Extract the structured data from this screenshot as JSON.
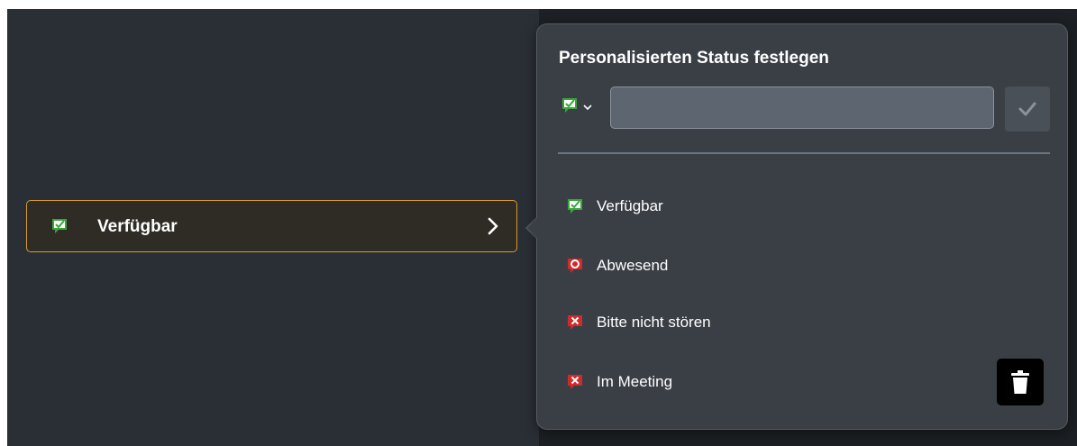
{
  "current_status": {
    "label": "Verfügbar",
    "icon": "status-available-icon",
    "border_color": "#d89a2e"
  },
  "popover": {
    "title": "Personalisierten Status festlegen",
    "icon_picker_icon": "status-available-icon",
    "input_value": "",
    "confirm_icon": "checkmark-icon",
    "delete_icon": "trash-icon"
  },
  "options": [
    {
      "label": "Verfügbar",
      "icon": "status-available-icon",
      "color": "#3aa63a"
    },
    {
      "label": "Abwesend",
      "icon": "status-away-icon",
      "color": "#d12a2a"
    },
    {
      "label": "Bitte nicht stören",
      "icon": "status-dnd-icon",
      "color": "#d12a2a"
    },
    {
      "label": "Im Meeting",
      "icon": "status-meeting-icon",
      "color": "#d12a2a"
    }
  ]
}
